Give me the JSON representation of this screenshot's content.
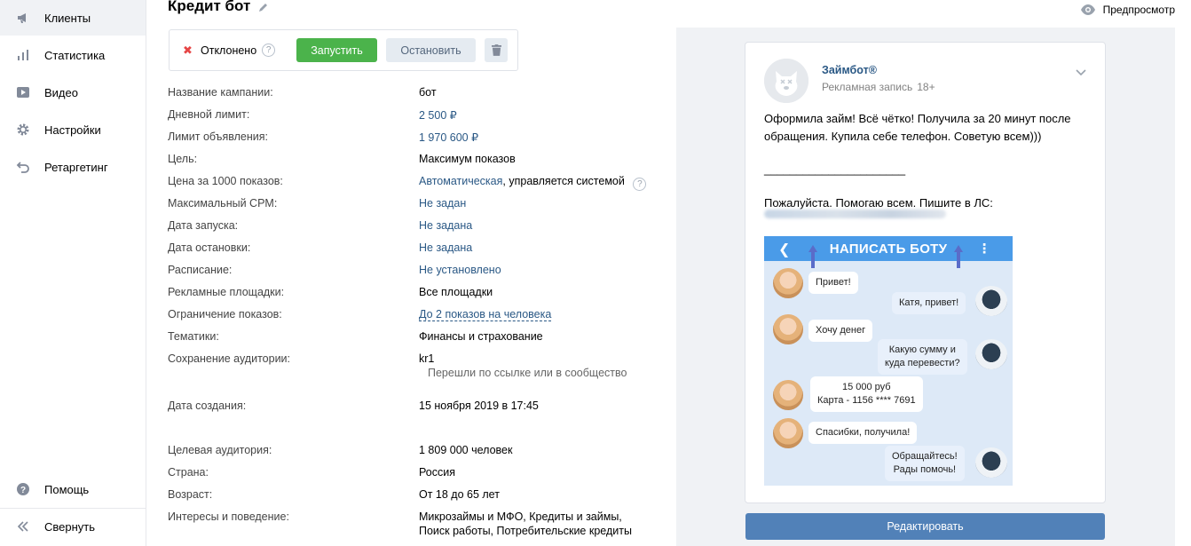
{
  "sidebar": {
    "items": [
      {
        "label": "Клиенты",
        "icon": "megaphone-icon"
      },
      {
        "label": "Статистика",
        "icon": "bar-chart-icon"
      },
      {
        "label": "Видео",
        "icon": "video-icon"
      },
      {
        "label": "Настройки",
        "icon": "gear-icon"
      },
      {
        "label": "Ретаргетинг",
        "icon": "retarget-icon"
      }
    ],
    "help": {
      "label": "Помощь",
      "icon": "help-icon"
    },
    "collapse": {
      "label": "Свернуть",
      "icon": "double-chevron-left-icon"
    }
  },
  "header": {
    "title": "Кредит бот",
    "preview_label": "Предпросмотр"
  },
  "status": {
    "text": "Отклонено",
    "help_mark": "?",
    "launch_label": "Запустить",
    "stop_label": "Остановить"
  },
  "details": [
    {
      "label": "Название кампании:",
      "value": "бот"
    },
    {
      "label": "Дневной лимит:",
      "value": "2 500 ₽"
    },
    {
      "label": "Лимит объявления:",
      "value": "1 970 600 ₽"
    },
    {
      "label": "Цель:",
      "value": "Максимум показов"
    },
    {
      "label": "Цена за 1000 показов:",
      "value": "Автоматическая",
      "suffix": ", управляется системой"
    },
    {
      "label": "Максимальный CPM:",
      "value": "Не задан"
    },
    {
      "label": "Дата запуска:",
      "value": "Не задана"
    },
    {
      "label": "Дата остановки:",
      "value": "Не задана"
    },
    {
      "label": "Расписание:",
      "value": "Не установлено"
    },
    {
      "label": "Рекламные площадки:",
      "value": "Все площадки"
    },
    {
      "label": "Ограничение показов:",
      "value": "До 2 показов на человека"
    },
    {
      "label": "Тематики:",
      "value": "Финансы и страхование"
    },
    {
      "label": "Сохранение аудитории:",
      "value": "kr1",
      "note": "Перешли по ссылке или в сообщество"
    },
    {
      "label": "Дата создания:",
      "value": "15 ноября 2019 в 17:45"
    },
    {
      "label": "Целевая аудитория:",
      "value": "1 809 000 человек"
    },
    {
      "label": "Страна:",
      "value": "Россия"
    },
    {
      "label": "Возраст:",
      "value": "От 18 до 65 лет"
    },
    {
      "label": "Интересы и поведение:",
      "value_line1": "Микрозаймы и МФО, Кредиты и займы,",
      "value_line2": "Поиск работы, Потребительские кредиты"
    }
  ],
  "post": {
    "author": "Займбот®",
    "subtitle": "Рекламная запись",
    "age_mark": "18+",
    "text_line1": "Оформила займ! Всё чётко! Получила за 20 минут после",
    "text_line2": "обращения. Купила себе телефон. Советую всем)))",
    "separator": "______________________",
    "text_line3": "Пожалуйста. Помогаю всем. Пишите в ЛС:"
  },
  "chat_image": {
    "header": "НАПИСАТЬ БОТУ",
    "messages": [
      {
        "from": "user",
        "text": "Привет!"
      },
      {
        "from": "bot",
        "text": "Катя, привет!"
      },
      {
        "from": "user",
        "text": "Хочу денег"
      },
      {
        "from": "bot",
        "line1": "Какую сумму и",
        "line2": "куда перевести?"
      },
      {
        "from": "user",
        "line1": "15 000 руб",
        "line2": "Карта - 1156 **** 7691"
      },
      {
        "from": "user",
        "text": "Спасибки, получила!"
      },
      {
        "from": "bot",
        "line1": "Обращайтесь!",
        "line2": "Рады помочь!"
      }
    ]
  },
  "edit_label": "Редактировать",
  "colors": {
    "accent": "#5181b8",
    "link": "#2a5885",
    "success": "#4bb34b",
    "danger": "#e64646",
    "panel_bg": "#f0f2f5",
    "chat_header": "#4a9be8"
  }
}
